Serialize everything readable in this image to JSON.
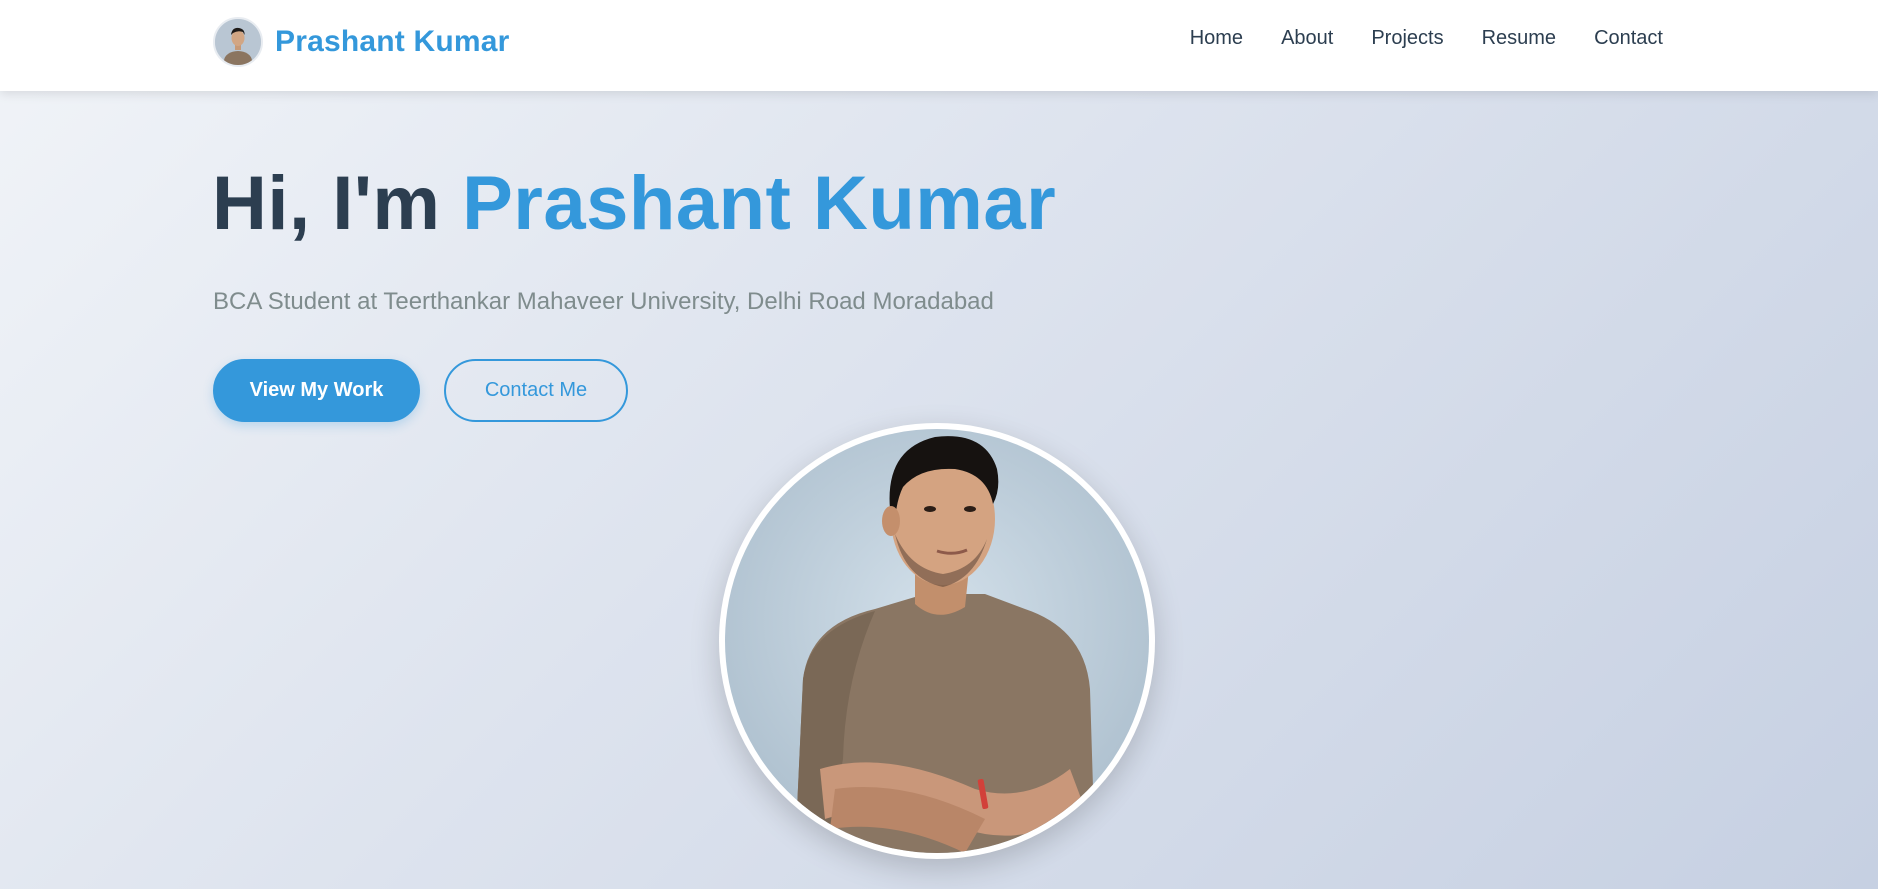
{
  "navbar": {
    "brand_name": "Prashant Kumar",
    "links": [
      "Home",
      "About",
      "Projects",
      "Resume",
      "Contact"
    ]
  },
  "hero": {
    "greeting": "Hi, I'm ",
    "name": "Prashant Kumar",
    "subtitle": "BCA Student at Teerthankar Mahaveer University, Delhi Road Moradabad",
    "primary_button": "View My Work",
    "secondary_button": "Contact Me"
  },
  "colors": {
    "accent": "#3498db",
    "heading": "#2c3e50",
    "subtitle": "#7f8c8d",
    "nav_background": "#ffffff"
  }
}
